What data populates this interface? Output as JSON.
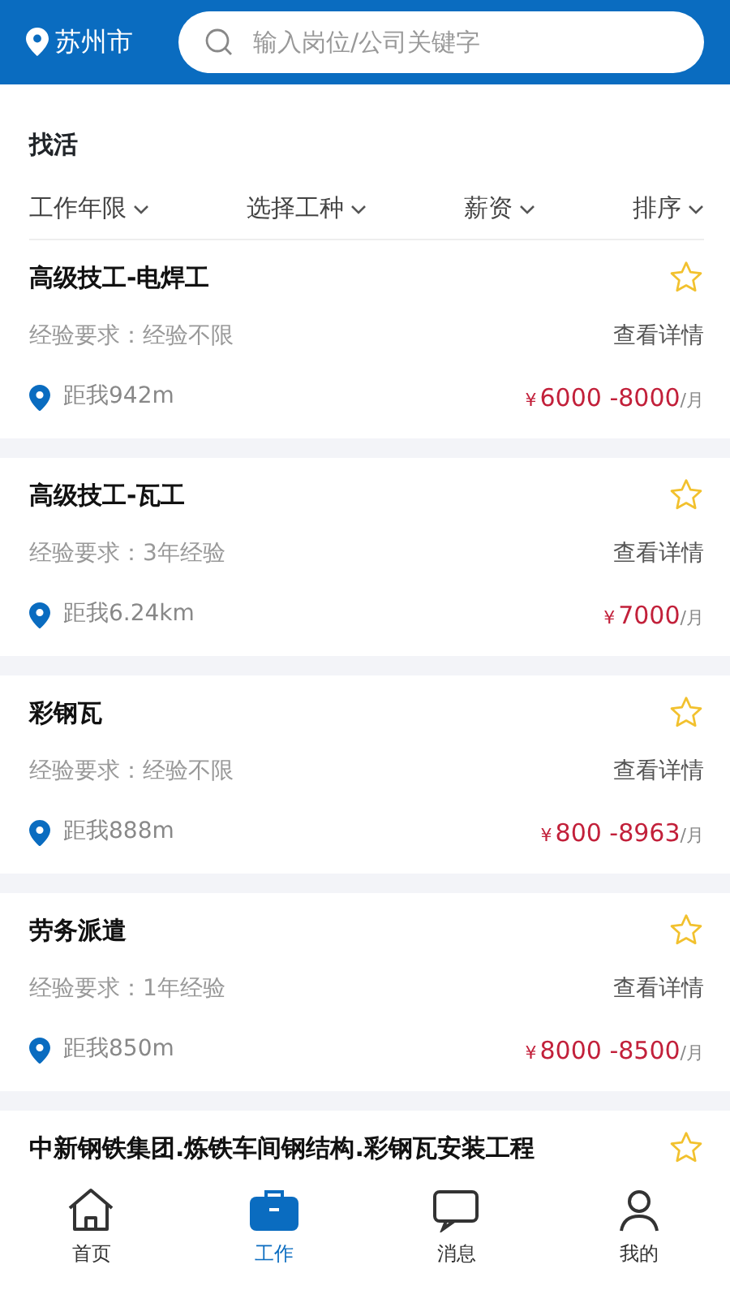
{
  "header": {
    "city": "苏州市",
    "search": {
      "placeholder": "输入岗位/公司关键字"
    }
  },
  "section_title": "找活",
  "filters": [
    {
      "label": "工作年限"
    },
    {
      "label": "选择工种"
    },
    {
      "label": "薪资"
    },
    {
      "label": "排序"
    }
  ],
  "jobs": [
    {
      "title": "高级技工-电焊工",
      "starred": false,
      "experience": "经验要求：经验不限",
      "details_link": "查看详情",
      "distance": "距我942m",
      "currency": "¥",
      "salary": "6000 -8000",
      "unit": "/月"
    },
    {
      "title": "高级技工-瓦工",
      "starred": false,
      "experience": "经验要求：3年经验",
      "details_link": "查看详情",
      "distance": "距我6.24km",
      "currency": "¥",
      "salary": "7000",
      "unit": "/月"
    },
    {
      "title": "彩钢瓦",
      "starred": false,
      "experience": "经验要求：经验不限",
      "details_link": "查看详情",
      "distance": "距我888m",
      "currency": "¥",
      "salary": "800 -8963",
      "unit": "/月"
    },
    {
      "title": "劳务派遣",
      "starred": false,
      "experience": "经验要求：1年经验",
      "details_link": "查看详情",
      "distance": "距我850m",
      "currency": "¥",
      "salary": "8000 -8500",
      "unit": "/月"
    },
    {
      "title": "中新钢铁集团.炼铁车间钢结构.彩钢瓦安装工程",
      "starred": false
    }
  ],
  "bottom_nav": [
    {
      "label": "首页",
      "kind": "home",
      "selected": false
    },
    {
      "label": "工作",
      "kind": "work",
      "selected": true
    },
    {
      "label": "消息",
      "kind": "message",
      "selected": false
    },
    {
      "label": "我的",
      "kind": "profile",
      "selected": false
    }
  ]
}
